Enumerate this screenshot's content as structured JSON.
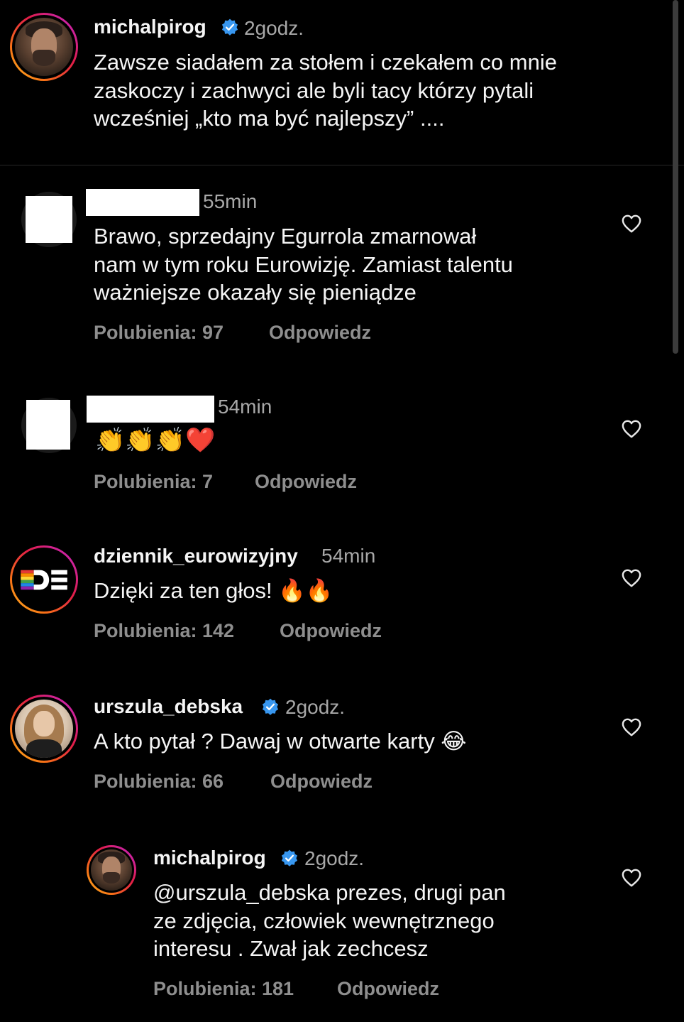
{
  "caption": {
    "username": "michalpirog",
    "verified": true,
    "time": "2godz.",
    "text": "Zawsze siadałem za stołem i czekałem co mnie\nzaskoczy i zachwyci ale byli tacy którzy pytali\nwcześniej „kto ma być najlepszy” ...."
  },
  "comments": [
    {
      "username": "",
      "redacted": true,
      "time": "55min",
      "text": "Brawo, sprzedajny Egurrola zmarnował\nnam w tym roku Eurowizję. Zamiast talentu\nważniejsze okazały się pieniądze",
      "likes": "Polubienia: 97",
      "reply": "Odpowiedz"
    },
    {
      "username": "",
      "redacted": true,
      "time": "54min",
      "text": "👏👏👏❤️",
      "likes": "Polubienia: 7",
      "reply": "Odpowiedz"
    },
    {
      "username": "dziennik_eurowizyjny",
      "verified": false,
      "time": "54min",
      "text": "Dzięki za ten głos! 🔥🔥",
      "likes": "Polubienia: 142",
      "reply": "Odpowiedz"
    },
    {
      "username": "urszula_debska",
      "verified": true,
      "time": "2godz.",
      "text": "A kto pytał ? Dawaj w otwarte karty 😂",
      "likes": "Polubienia: 66",
      "reply": "Odpowiedz"
    },
    {
      "username": "michalpirog",
      "verified": true,
      "time": "2godz.",
      "text": "@urszula_debska prezes, drugi pan\nze zdjęcia, człowiek wewnętrznego\ninteresu . Zwał jak zechcesz",
      "likes": "Polubienia: 181",
      "reply": "Odpowiedz"
    }
  ],
  "icons": {
    "verified": "verified-badge-icon",
    "like": "heart-icon"
  },
  "colors": {
    "background": "#000000",
    "primary_text": "#f5f5f5",
    "secondary_text": "#a8a8a8",
    "verified_blue": "#3897f0"
  }
}
